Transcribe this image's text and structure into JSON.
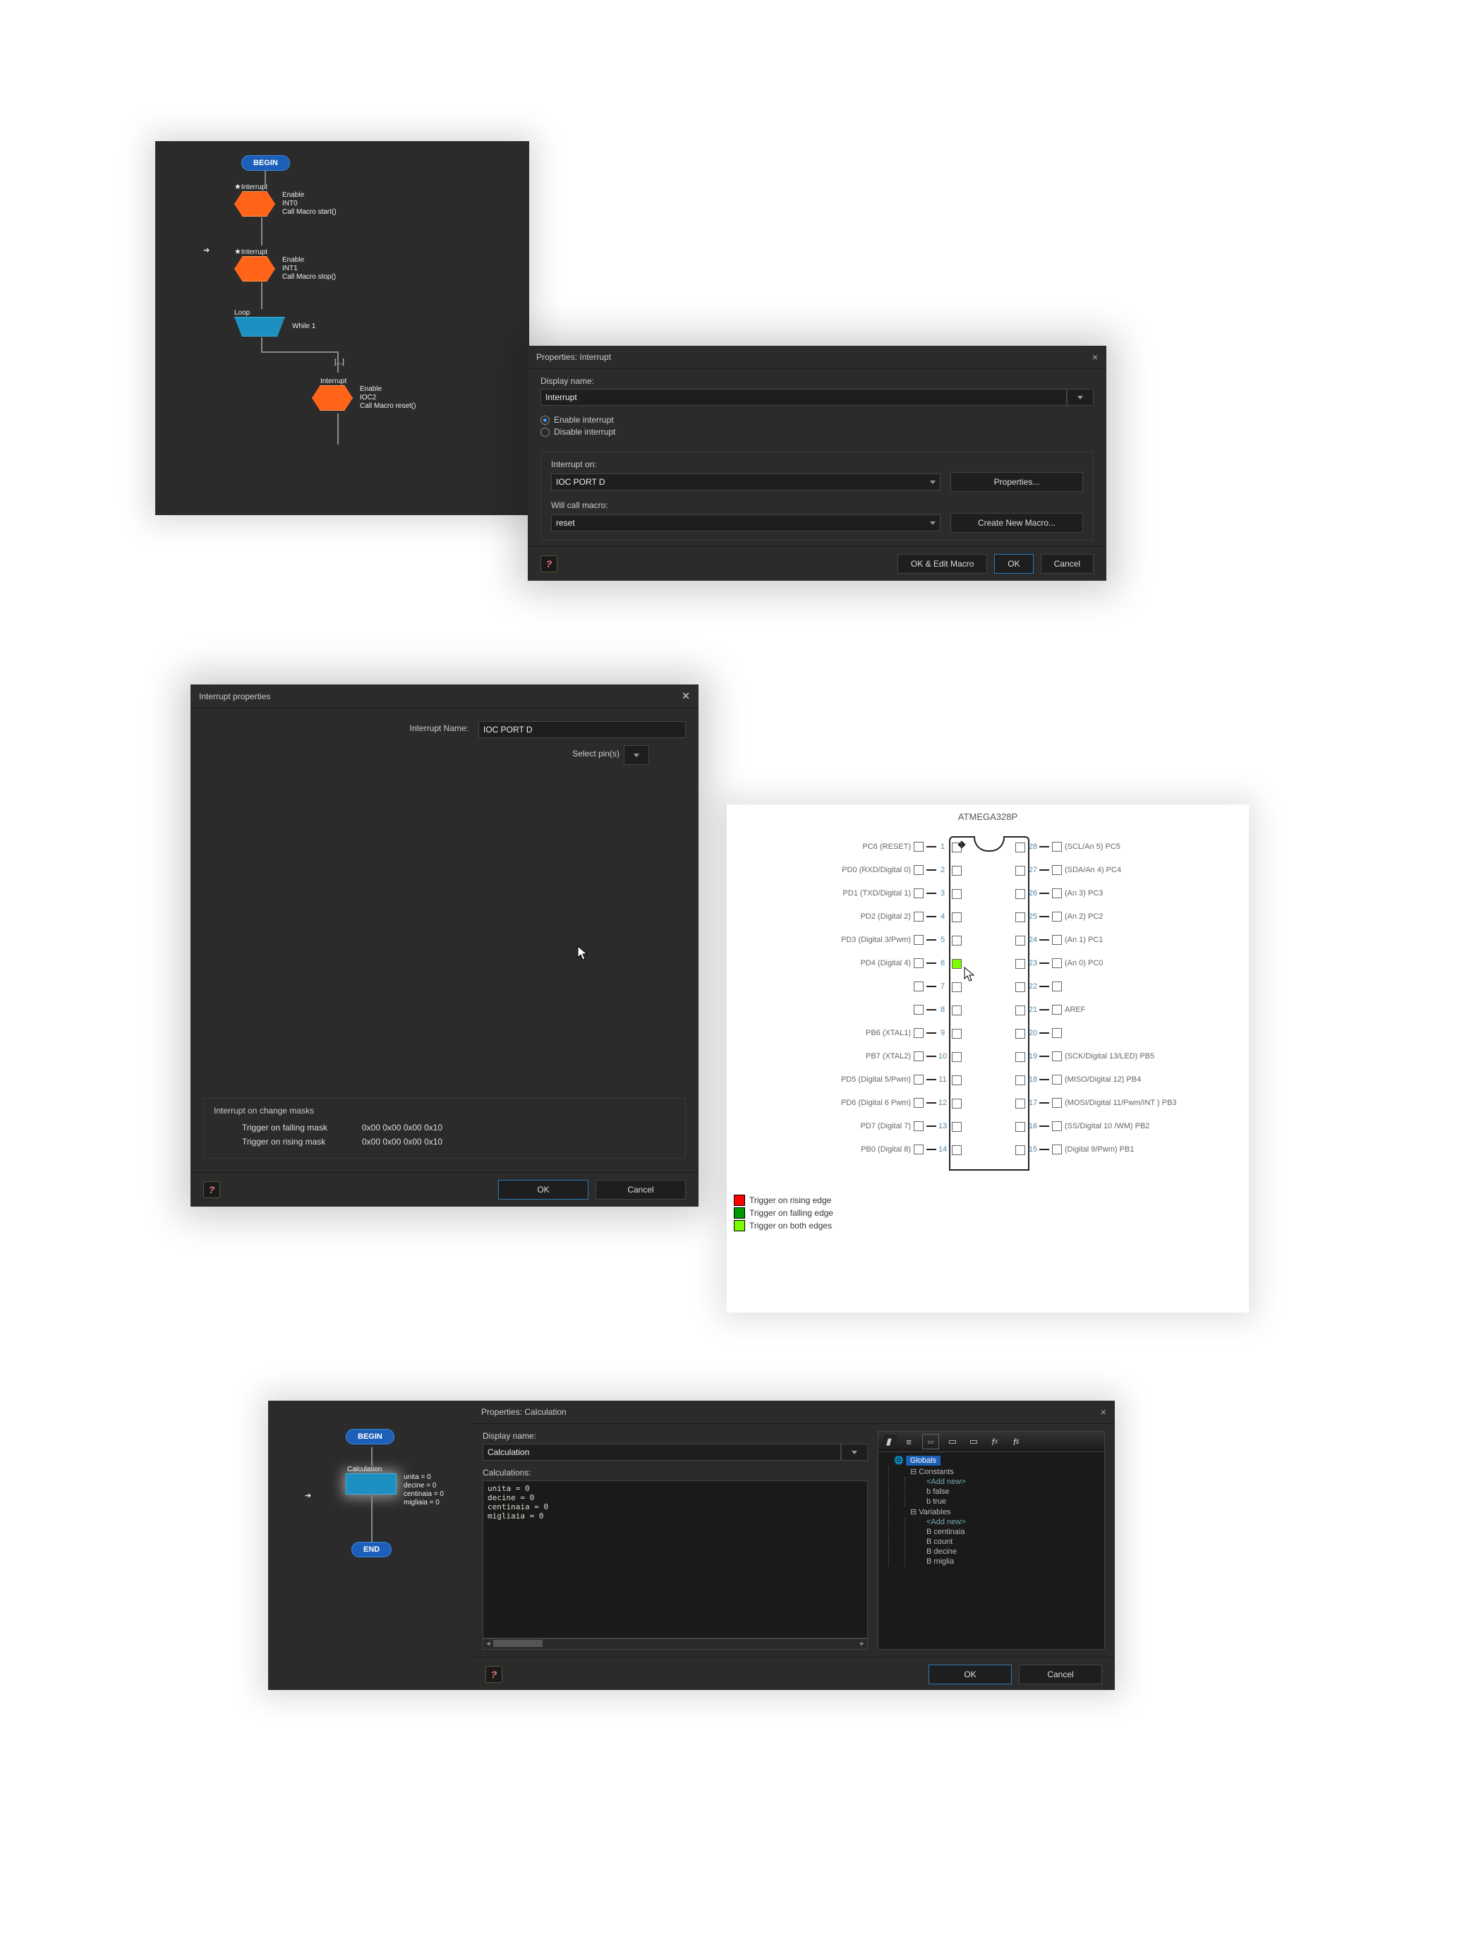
{
  "flow1": {
    "begin": "BEGIN",
    "int1": {
      "tag": "Interrupt",
      "l1": "Enable",
      "l2": "INT0",
      "l3": "Call Macro start()"
    },
    "int2": {
      "tag": "Interrupt",
      "l1": "Enable",
      "l2": "INT1",
      "l3": "Call Macro stop()"
    },
    "loop": {
      "tag": "Loop",
      "l": "While 1",
      "body": "[...]"
    },
    "int3": {
      "tag": "Interrupt",
      "l1": "Enable",
      "l2": "IOC2",
      "l3": "Call Macro reset()"
    }
  },
  "propsInterrupt": {
    "title": "Properties: Interrupt",
    "displayname_label": "Display name:",
    "displayname": "Interrupt",
    "enable": "Enable interrupt",
    "disable": "Disable interrupt",
    "intOnLabel": "Interrupt on:",
    "intOn": "IOC PORT D",
    "propsBtn": "Properties...",
    "callMacroLabel": "Will call macro:",
    "callMacro": "reset",
    "createBtn": "Create New Macro...",
    "okedit": "OK & Edit Macro",
    "ok": "OK",
    "cancel": "Cancel"
  },
  "intProps": {
    "title": "Interrupt properties",
    "nameLabel": "Interrupt Name:",
    "name": "IOC PORT D",
    "selectPins": "Select pin(s)",
    "masksHeader": "Interrupt on change masks",
    "fallLabel": "Trigger on falling mask",
    "fallVal": "0x00 0x00 0x00 0x10",
    "riseLabel": "Trigger on rising mask",
    "riseVal": "0x00 0x00 0x00 0x10",
    "ok": "OK",
    "cancel": "Cancel"
  },
  "chip": {
    "title": "ATMEGA328P",
    "left": [
      {
        "n": "1",
        "l": "PC6 (RESET)"
      },
      {
        "n": "2",
        "l": "PD0 (RXD/Digital 0)"
      },
      {
        "n": "3",
        "l": "PD1 (TXD/Digital 1)"
      },
      {
        "n": "4",
        "l": "PD2 (Digital 2)"
      },
      {
        "n": "5",
        "l": "PD3 (Digital 3/Pwm)"
      },
      {
        "n": "6",
        "l": "PD4 (Digital 4)"
      },
      {
        "n": "7",
        "l": ""
      },
      {
        "n": "8",
        "l": ""
      },
      {
        "n": "9",
        "l": "PB6 (XTAL1)"
      },
      {
        "n": "10",
        "l": "PB7 (XTAL2)"
      },
      {
        "n": "11",
        "l": "PD5 (Digital 5/Pwm)"
      },
      {
        "n": "12",
        "l": "PD6 (Digital 6 Pwm)"
      },
      {
        "n": "13",
        "l": "PD7 (Digital 7)"
      },
      {
        "n": "14",
        "l": "PB0 (Digital 8)"
      }
    ],
    "right": [
      {
        "n": "28",
        "l": "(SCL/An 5) PC5"
      },
      {
        "n": "27",
        "l": "(SDA/An 4) PC4"
      },
      {
        "n": "26",
        "l": "(An 3) PC3"
      },
      {
        "n": "25",
        "l": "(An 2) PC2"
      },
      {
        "n": "24",
        "l": "(An 1) PC1"
      },
      {
        "n": "23",
        "l": "(An 0) PC0"
      },
      {
        "n": "22",
        "l": ""
      },
      {
        "n": "21",
        "l": "AREF"
      },
      {
        "n": "20",
        "l": ""
      },
      {
        "n": "19",
        "l": "(SCK/Digital 13/LED) PB5"
      },
      {
        "n": "18",
        "l": "(MISO/Digital 12)  PB4"
      },
      {
        "n": "17",
        "l": "(MOSI/Digital 11/Pwm/INT ) PB3"
      },
      {
        "n": "16",
        "l": "(SS/Digital 10 /WM) PB2"
      },
      {
        "n": "15",
        "l": "(Digital 9/Pwm) PB1"
      }
    ],
    "legend": {
      "rise": "Trigger on rising edge",
      "fall": "Trigger on falling edge",
      "both": "Trigger on both edges"
    }
  },
  "flow2": {
    "begin": "BEGIN",
    "calc": {
      "tag": "Calculation",
      "l1": "unita = 0",
      "l2": "decine = 0",
      "l3": "centinaia = 0",
      "l4": "migliaia = 0"
    },
    "end": "END"
  },
  "propsCalc": {
    "title": "Properties: Calculation",
    "displayname_label": "Display name:",
    "displayname": "Calculation",
    "calcsLabel": "Calculations:",
    "code": "unita = 0\ndecine = 0\ncentinaia = 0\nmigliaia = 0",
    "ok": "OK",
    "cancel": "Cancel"
  },
  "tree": {
    "globals": "Globals",
    "constants": "Constants",
    "add": "<Add new>",
    "false": "false",
    "true": "true",
    "variables": "Variables",
    "v1": "centinaia",
    "v2": "count",
    "v3": "decine",
    "v4": "miglia"
  }
}
